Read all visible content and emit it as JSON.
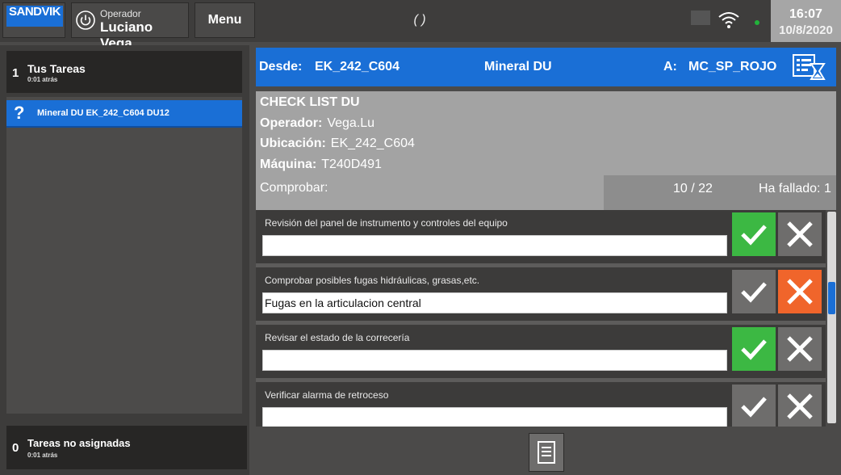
{
  "header": {
    "logo_text": "SANDVIK",
    "operator_caption": "Operador",
    "operator_name": "Luciano Vega",
    "menu_label": "Menu",
    "center_status": "( )",
    "time": "16:07",
    "date": "10/8/2020",
    "icons": [
      "power-icon",
      "wifi-icon",
      "status-dot"
    ]
  },
  "sidebar": {
    "tasks_count": "1",
    "tasks_title": "Tus Tareas",
    "tasks_sub": "0:01 atrás",
    "items": [
      {
        "icon": "?",
        "label": "Mineral DU  EK_242_C604  DU12"
      }
    ],
    "unassigned_count": "0",
    "unassigned_title": "Tareas no asignadas",
    "unassigned_sub": "0:01 atrás"
  },
  "route": {
    "from_label": "Desde:",
    "from_value": "EK_242_C604",
    "material": "Mineral DU",
    "to_label": "A:",
    "to_value": "MC_SP_ROJO",
    "icon": "list-hourglass-icon"
  },
  "info": {
    "title": "CHECK LIST DU",
    "operator_label": "Operador:",
    "operator_value": "Vega.Lu",
    "location_label": "Ubicación:",
    "location_value": "EK_242_C604",
    "machine_label": "Máquina:",
    "machine_value": "T240D491",
    "check_label": "Comprobar:",
    "progress": "10  /  22",
    "failed": "Ha fallado: 1"
  },
  "checklist": [
    {
      "question": "Revisión del panel de instrumento y controles del equipo",
      "value": "",
      "ok_active": true,
      "fail_active": false
    },
    {
      "question": "Comprobar posibles fugas hidráulicas, grasas,etc.",
      "value": "Fugas en la articulacion central",
      "ok_active": false,
      "fail_active": true
    },
    {
      "question": "Revisar el estado de la correcería",
      "value": "",
      "ok_active": true,
      "fail_active": false
    },
    {
      "question": "Verificar alarma de retroceso",
      "value": "",
      "ok_active": false,
      "fail_active": false
    }
  ],
  "colors": {
    "accent_blue": "#1a6fd6",
    "ok_green": "#3cb843",
    "fail_orange": "#f0652b"
  }
}
